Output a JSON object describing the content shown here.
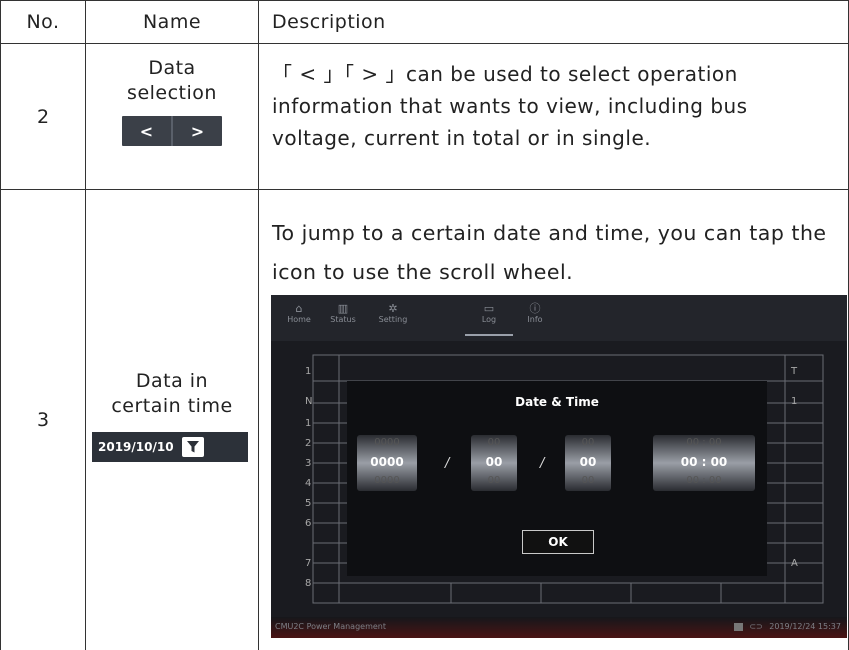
{
  "header": {
    "no": "No.",
    "name": "Name",
    "description": "Description"
  },
  "rows": [
    {
      "no": "2",
      "name_line1": "Data",
      "name_line2": "selection",
      "buttons": [
        "<",
        ">"
      ],
      "description": "「 < 」「 > 」can be used to select operation information that wants to view, including bus voltage, current in total or in single."
    },
    {
      "no": "3",
      "name_line1": "Data in",
      "name_line2": "certain time",
      "date_value": "2019/10/10",
      "filter_icon": "filter-icon",
      "description": "To jump to a certain date and time, you can tap the icon to use the scroll wheel."
    }
  ],
  "screenshot": {
    "nav": [
      {
        "label": "Home",
        "icon": "home-icon"
      },
      {
        "label": "Status",
        "icon": "bar-chart-icon"
      },
      {
        "label": "Setting",
        "icon": "gear-icon"
      },
      {
        "label": "Log",
        "icon": "folder-icon"
      },
      {
        "label": "Info",
        "icon": "info-icon"
      }
    ],
    "grid_rows": [
      "1",
      "N",
      "1",
      "2",
      "3",
      "4",
      "5",
      "6",
      "7",
      "8"
    ],
    "right_col": [
      "T",
      "1",
      "",
      "",
      "",
      "",
      "",
      "",
      "A",
      ""
    ],
    "modal_title": "Date & Time",
    "year": {
      "prev": "0000",
      "sel": "0000",
      "next": "0000"
    },
    "month": {
      "prev": "00",
      "sel": "00",
      "next": "00"
    },
    "day": {
      "prev": "00",
      "sel": "00",
      "next": "00"
    },
    "time": {
      "prev": "00 : 00",
      "sel": "00 : 00",
      "next": "00 : 00"
    },
    "separator": "/",
    "ok_label": "OK",
    "footer_left": "CMU2C Power Management",
    "footer_right": "2019/12/24 15:37"
  }
}
